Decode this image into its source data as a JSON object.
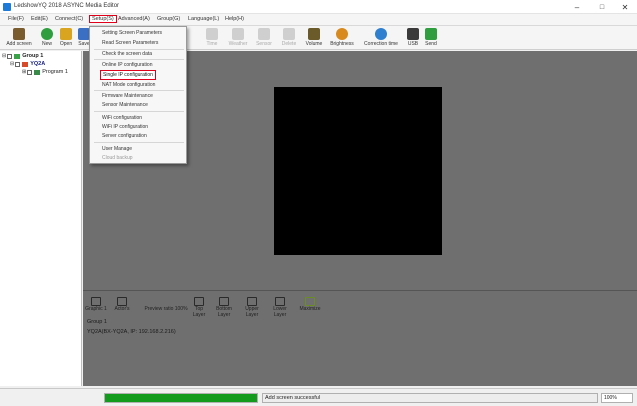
{
  "window": {
    "title": "LedshowYQ 2018 ASYNC Media Editor",
    "minimize": "–",
    "maximize": "□",
    "close": "✕"
  },
  "menubar": [
    {
      "label": "File(F)"
    },
    {
      "label": "Edit(E)"
    },
    {
      "label": "Connect(C)"
    },
    {
      "label": "Setup(S)"
    },
    {
      "label": "Advanced(A)"
    },
    {
      "label": "Group(G)"
    },
    {
      "label": "Language(L)"
    },
    {
      "label": "Help(H)"
    }
  ],
  "toolbar": [
    {
      "label": "Add screen",
      "icon": "wand-icon",
      "color": "#7a5c2e",
      "disabled": false
    },
    {
      "label": "New",
      "icon": "new-icon",
      "color": "#2e9e3e",
      "disabled": false
    },
    {
      "label": "Open",
      "icon": "folder-icon",
      "color": "#d9a520",
      "disabled": false
    },
    {
      "label": "Save",
      "icon": "save-icon",
      "color": "#3a6fc4",
      "disabled": false
    },
    {
      "label": "Time",
      "icon": "calendar-icon",
      "color": "#999999",
      "disabled": true
    },
    {
      "label": "Weather",
      "icon": "weather-icon",
      "color": "#999999",
      "disabled": true
    },
    {
      "label": "Sensor",
      "icon": "sensor-icon",
      "color": "#999999",
      "disabled": true
    },
    {
      "label": "Delete",
      "icon": "delete-icon",
      "color": "#999999",
      "disabled": true
    },
    {
      "label": "Volume",
      "icon": "music-icon",
      "color": "#6b5a2a",
      "disabled": false
    },
    {
      "label": "Brightness",
      "icon": "bulb-icon",
      "color": "#d98a1c",
      "disabled": false
    },
    {
      "label": "Correction time",
      "icon": "clock-icon",
      "color": "#2e7fd0",
      "disabled": false
    },
    {
      "label": "USB",
      "icon": "usb-icon",
      "color": "#3a3a3a",
      "disabled": false
    },
    {
      "label": "Send",
      "icon": "send-icon",
      "color": "#2e9e3e",
      "disabled": false
    }
  ],
  "tree": {
    "group": "Group 1",
    "screen": "YQ2A",
    "program": "Program 1"
  },
  "setup_menu": {
    "items": [
      {
        "label": "Setting Screen Parameters",
        "disabled": false
      },
      {
        "label": "Read Screen Parameters",
        "disabled": false
      },
      {
        "label": "Check the screen data",
        "disabled": false
      },
      {
        "label": "Online IP configuration",
        "disabled": false
      },
      {
        "label": "Single IP configuration",
        "disabled": false,
        "highlight": true
      },
      {
        "label": "NAT Mode configuration",
        "disabled": false
      },
      {
        "label": "Firmware Maintenance",
        "disabled": false
      },
      {
        "label": "Sensor Maintenance",
        "disabled": false
      },
      {
        "label": "WiFi configuration",
        "disabled": false
      },
      {
        "label": "WiFi IP configuration",
        "disabled": false
      },
      {
        "label": "Server configuration",
        "disabled": false
      },
      {
        "label": "User Manage",
        "disabled": false
      },
      {
        "label": "Cloud backup",
        "disabled": true
      }
    ]
  },
  "bottom_toolbar": [
    {
      "label": "Graphic 1"
    },
    {
      "label": "Actor's"
    },
    {
      "label": "Preview ratio 100%"
    },
    {
      "label": "Top Layer"
    },
    {
      "label": "Bottom Layer"
    },
    {
      "label": "Upper Layer"
    },
    {
      "label": "Lower Layer"
    },
    {
      "label": "Maximize"
    }
  ],
  "info": {
    "group_line": "Group 1",
    "screen_line": "YQ2A(BX-YQ2A, IP: 192.168.2.216)"
  },
  "statusbar": {
    "progress_percent": 100,
    "message": "Add screen successful",
    "zoom": "100%"
  },
  "colors": {
    "highlight_border": "#e0001b",
    "progress": "#139b1e",
    "preview_bg": "#6f6f6f",
    "screen": "#000000"
  }
}
